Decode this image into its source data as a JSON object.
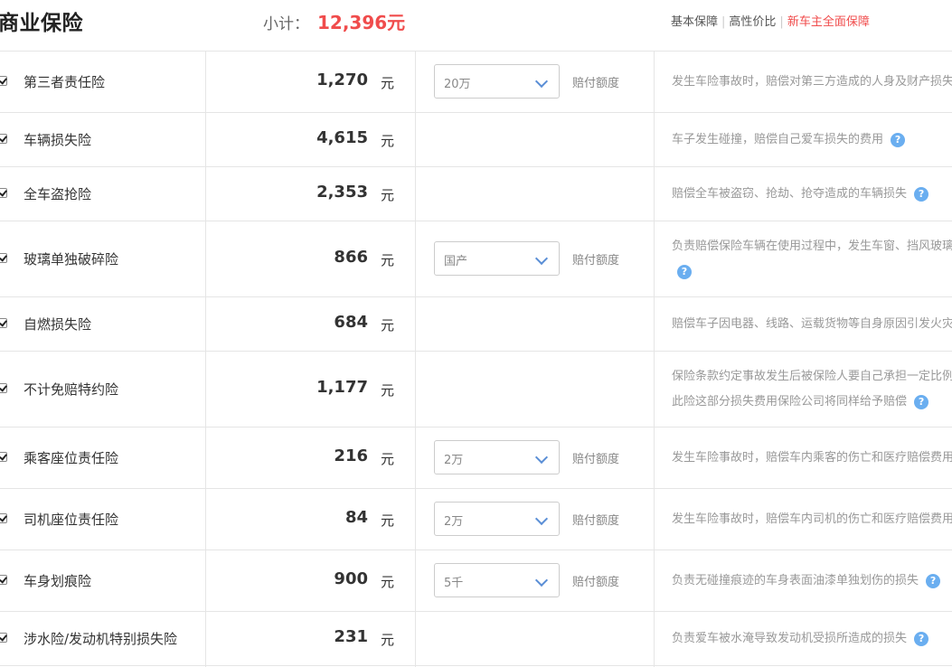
{
  "header": {
    "title": "商业保险",
    "subtotal_label": "小计：",
    "subtotal_amount": "12,396元",
    "plans": [
      "基本保障",
      "高性价比",
      "新车主全面保障"
    ]
  },
  "select_label": "赔付额度",
  "unit": "元",
  "help_icon_glyph": "?",
  "colors": {
    "accent_red": "#f04c4c",
    "help_blue": "#6aaef0",
    "chevron_blue": "#5b8fd6"
  },
  "items": [
    {
      "name": "第三者责任险",
      "price": "1,270",
      "option": "20万",
      "desc": "发生车险事故时，赔偿对第三方造成的人身及财产损失"
    },
    {
      "name": "车辆损失险",
      "price": "4,615",
      "desc": "车子发生碰撞，赔偿自己爱车损失的费用"
    },
    {
      "name": "全车盗抢险",
      "price": "2,353",
      "desc": "赔偿全车被盗窃、抢劫、抢夺造成的车辆损失"
    },
    {
      "name": "玻璃单独破碎险",
      "price": "866",
      "option": "国产",
      "desc": "负责赔偿保险车辆在使用过程中，发生车窗、挡风玻璃"
    },
    {
      "name": "自燃损失险",
      "price": "684",
      "desc": "赔偿车子因电器、线路、运载货物等自身原因引发火灾"
    },
    {
      "name": "不计免赔特约险",
      "price": "1,177",
      "desc": "保险条款约定事故发生后被保险人要自己承担一定比例",
      "desc2": "此险这部分损失费用保险公司将同样给予赔偿"
    },
    {
      "name": "乘客座位责任险",
      "price": "216",
      "option": "2万",
      "desc": "发生车险事故时，赔偿车内乘客的伤亡和医疗赔偿费用"
    },
    {
      "name": "司机座位责任险",
      "price": "84",
      "option": "2万",
      "desc": "发生车险事故时，赔偿车内司机的伤亡和医疗赔偿费用"
    },
    {
      "name": "车身划痕险",
      "price": "900",
      "option": "5千",
      "desc": "负责无碰撞痕迹的车身表面油漆单独划伤的损失"
    },
    {
      "name": "涉水险/发动机特别损失险",
      "price": "231",
      "desc": "负责爱车被水淹导致发动机受损所造成的损失"
    }
  ]
}
